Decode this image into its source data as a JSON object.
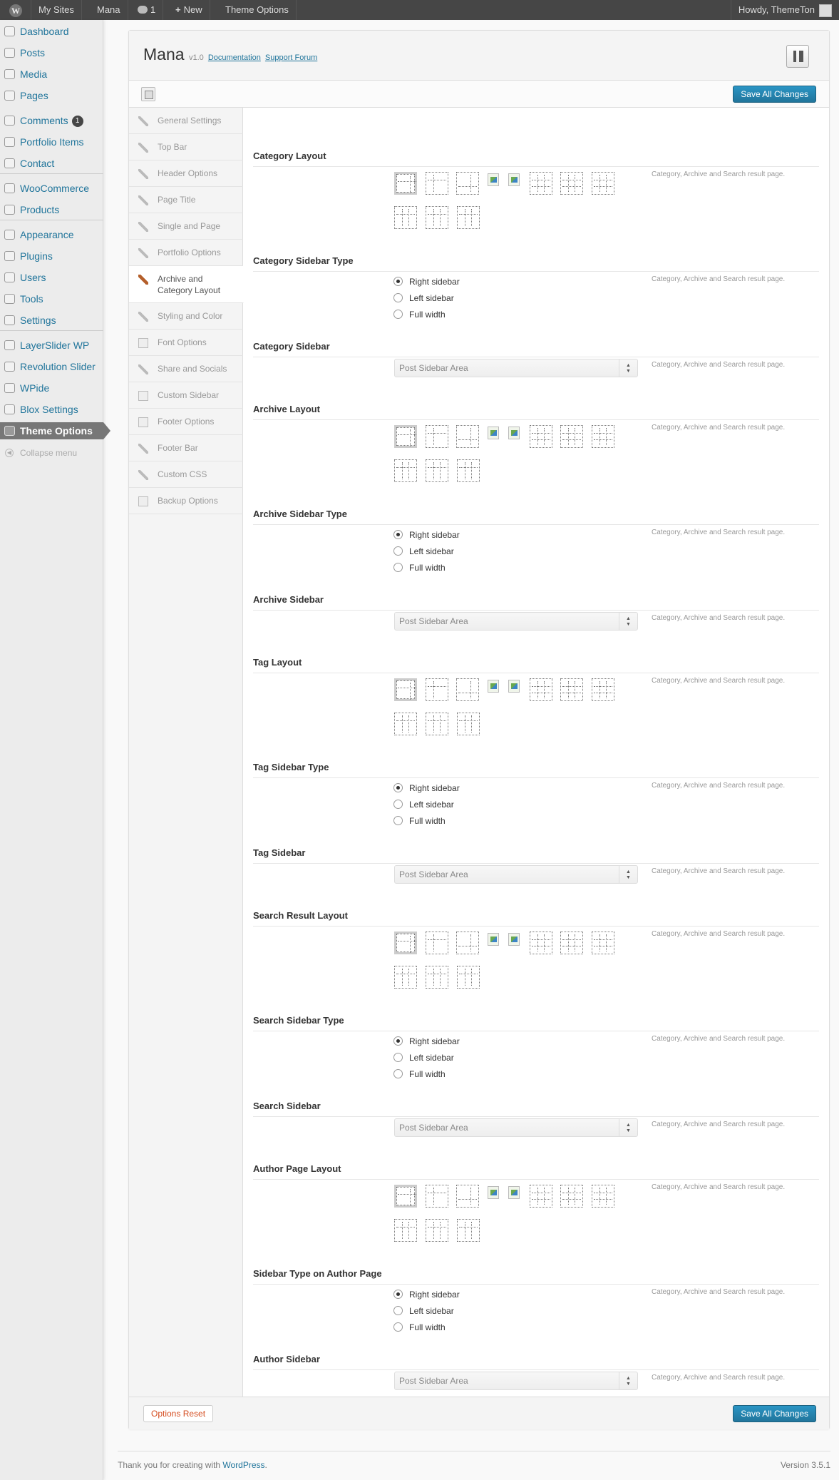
{
  "adminbar": {
    "my_sites": "My Sites",
    "site_name": "Mana",
    "comments_count": "1",
    "new_label": "New",
    "theme_options": "Theme Options",
    "howdy": "Howdy, ThemeTon"
  },
  "menu": {
    "items": [
      {
        "label": "Dashboard",
        "icon": "dashboard-icon"
      },
      {
        "label": "Posts",
        "icon": "pin-icon"
      },
      {
        "label": "Media",
        "icon": "media-icon"
      },
      {
        "label": "Pages",
        "icon": "pages-icon"
      },
      {
        "label": "Comments",
        "icon": "comments-icon",
        "badge": "1"
      },
      {
        "label": "Portfolio Items",
        "icon": "pin-icon"
      },
      {
        "label": "Contact",
        "icon": "contact-icon"
      },
      {
        "label": "WooCommerce",
        "icon": "woocommerce-icon"
      },
      {
        "label": "Products",
        "icon": "products-icon"
      },
      {
        "label": "Appearance",
        "icon": "appearance-icon"
      },
      {
        "label": "Plugins",
        "icon": "plugins-icon"
      },
      {
        "label": "Users",
        "icon": "users-icon"
      },
      {
        "label": "Tools",
        "icon": "tools-icon"
      },
      {
        "label": "Settings",
        "icon": "settings-icon"
      },
      {
        "label": "LayerSlider WP",
        "icon": "gear-icon"
      },
      {
        "label": "Revolution Slider",
        "icon": "gear-icon"
      },
      {
        "label": "WPide",
        "icon": "gear-icon"
      },
      {
        "label": "Blox Settings",
        "icon": "gear-icon"
      },
      {
        "label": "Theme Options",
        "icon": "gear-icon",
        "active": true
      }
    ],
    "collapse": "Collapse menu"
  },
  "panel": {
    "title": "Mana",
    "version": "v1.0",
    "documentation": "Documentation",
    "support": "Support Forum",
    "save_label": "Save All Changes",
    "reset_label": "Options Reset"
  },
  "tabs": [
    "General Settings",
    "Top Bar",
    "Header Options",
    "Page Title",
    "Single and Page",
    "Portfolio Options",
    "Archive and Category Layout",
    "Styling and Color",
    "Font Options",
    "Share and Socials",
    "Custom Sidebar",
    "Footer Options",
    "Footer Bar",
    "Custom CSS",
    "Backup Options"
  ],
  "active_tab": "Archive and Category Layout",
  "sections": [
    {
      "title": "Category Layout",
      "desc": "Category, Archive and Search result page."
    },
    {
      "title": "Category Sidebar Type",
      "desc": "Category, Archive and Search result page."
    },
    {
      "title": "Category Sidebar",
      "desc": "Category, Archive and Search result page."
    },
    {
      "title": "Archive Layout",
      "desc": "Category, Archive and Search result page."
    },
    {
      "title": "Archive Sidebar Type",
      "desc": "Category, Archive and Search result page."
    },
    {
      "title": "Archive Sidebar",
      "desc": "Category, Archive and Search result page."
    },
    {
      "title": "Tag Layout",
      "desc": "Category, Archive and Search result page."
    },
    {
      "title": "Tag Sidebar Type",
      "desc": "Category, Archive and Search result page."
    },
    {
      "title": "Tag Sidebar",
      "desc": "Category, Archive and Search result page."
    },
    {
      "title": "Search Result Layout",
      "desc": "Category, Archive and Search result page."
    },
    {
      "title": "Search Sidebar Type",
      "desc": "Category, Archive and Search result page."
    },
    {
      "title": "Search Sidebar",
      "desc": "Category, Archive and Search result page."
    },
    {
      "title": "Author Page Layout",
      "desc": "Category, Archive and Search result page."
    },
    {
      "title": "Sidebar Type on Author Page",
      "desc": "Category, Archive and Search result page."
    },
    {
      "title": "Author Sidebar",
      "desc": "Category, Archive and Search result page."
    }
  ],
  "radio_options": [
    "Right sidebar",
    "Left sidebar",
    "Full width"
  ],
  "selected_radio": "Right sidebar",
  "select_value": "Post Sidebar Area",
  "footer": {
    "thanks": "Thank you for creating with ",
    "wordpress": "WordPress",
    "period": ".",
    "version": "Version 3.5.1"
  }
}
